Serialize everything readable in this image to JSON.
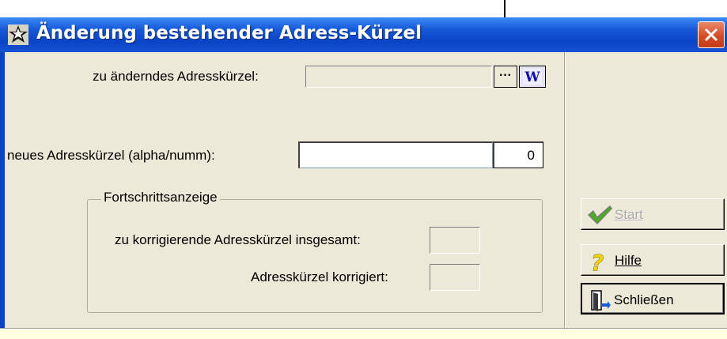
{
  "window": {
    "title": "Änderung bestehender Adress-Kürzel",
    "icon": "star-window-icon",
    "close_icon": "close-icon"
  },
  "form": {
    "current_label": "zu änderndes Adresskürzel:",
    "current_value": "",
    "browse_button_label": "···",
    "browse_icon": "ellipsis-icon",
    "lookup_icon": "w-lookup-icon",
    "new_label": "neues Adresskürzel (alpha/numm):",
    "new_value": "",
    "new_number": "0"
  },
  "progress": {
    "legend": "Fortschrittsanzeige",
    "total_label": "zu korrigierende Adresskürzel insgesamt:",
    "total_value": "",
    "corrected_label": "Adresskürzel korrigiert:",
    "corrected_value": ""
  },
  "buttons": {
    "start_label": "Start",
    "start_icon": "checkmark-icon",
    "help_label": "Hilfe",
    "help_icon": "question-mark-icon",
    "close_label": "Schließen",
    "close_icon": "door-exit-icon"
  },
  "colors": {
    "titlebar": "#0a44c6",
    "window_bg": "#ece9d8",
    "status_bg": "#ffffe1",
    "close_button": "#d84a26"
  }
}
